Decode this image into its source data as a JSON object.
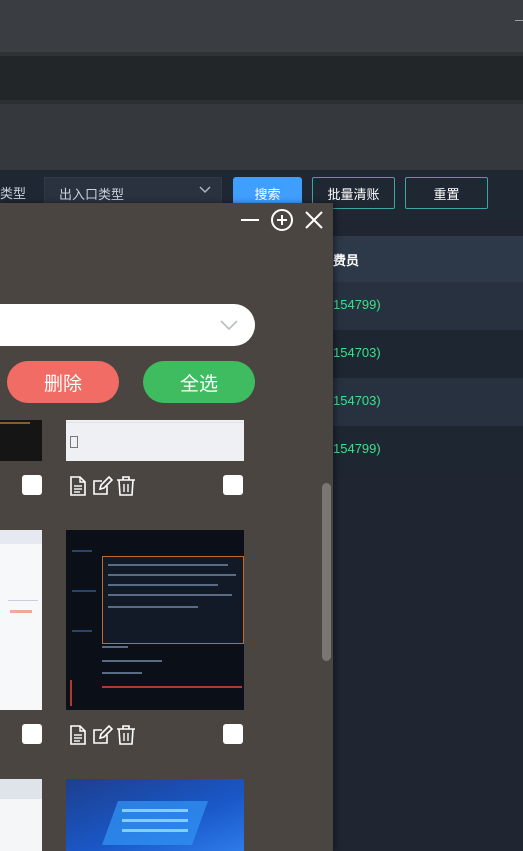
{
  "filter": {
    "label_partial": "类型",
    "select_value": "出入口类型",
    "search_label": "搜索",
    "batch_label": "批量清账",
    "reset_label": "重置"
  },
  "table": {
    "header_partial": "费员",
    "rows": [
      "154799)",
      "154703)",
      "154703)",
      "154799)"
    ]
  },
  "modal": {
    "delete_label": "删除",
    "select_all_label": "全选",
    "window_icons": [
      "minimize-icon",
      "zoom-in-icon",
      "close-icon"
    ],
    "item_action_icons": [
      "document-icon",
      "edit-icon",
      "trash-icon"
    ]
  }
}
